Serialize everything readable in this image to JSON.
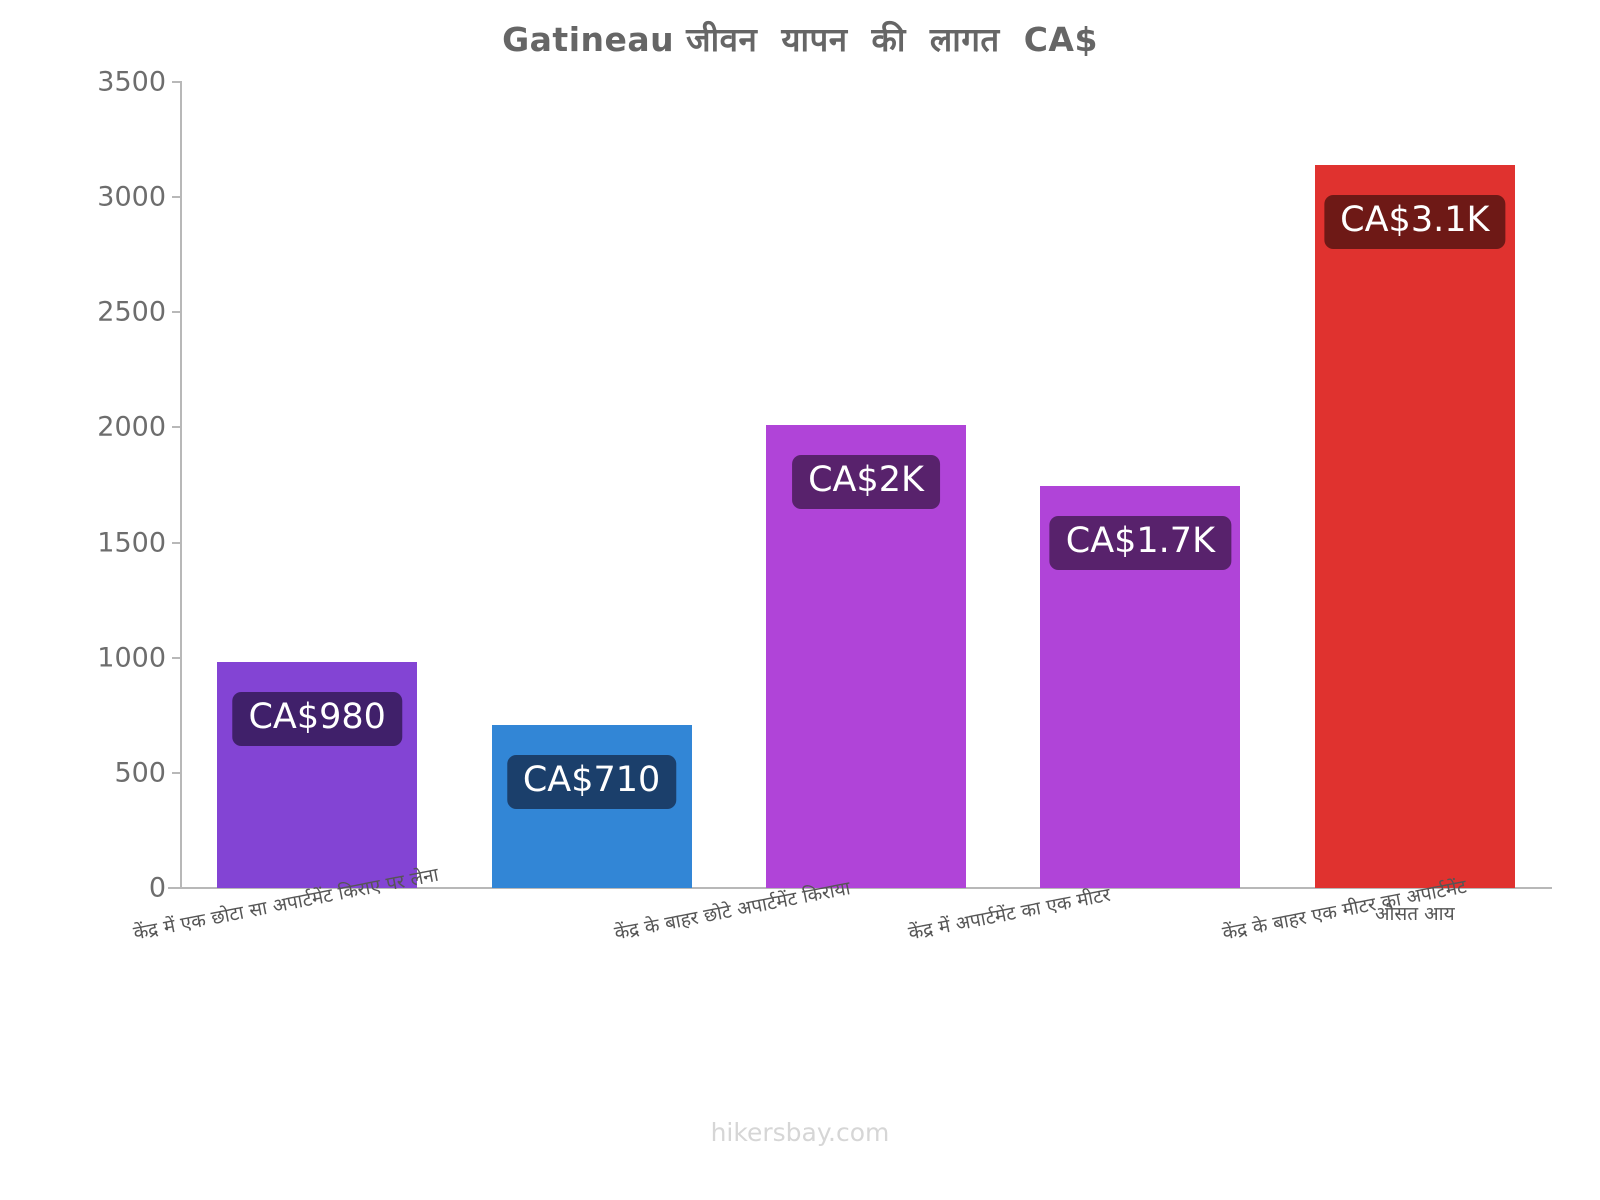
{
  "chart_data": {
    "type": "bar",
    "title": "Gatineau जीवन  यापन  की  लागत  CA$",
    "xlabel": "",
    "ylabel": "",
    "ylim": [
      0,
      3500
    ],
    "yticks": [
      0,
      500,
      1000,
      1500,
      2000,
      2500,
      3000,
      3500
    ],
    "ytick_labels": [
      "0",
      "500",
      "1000",
      "1500",
      "2000",
      "2500",
      "3000",
      "3500"
    ],
    "grid": false,
    "legend": "none",
    "categories": [
      "केंद्र में एक छोटा सा अपार्टमेंट किराए पर लेना",
      "केंद्र के बाहर छोटे अपार्टमेंट किराया",
      "केंद्र में अपार्टमेंट का एक मीटर",
      "केंद्र के बाहर एक मीटर का अपार्टमेंट",
      "औसत आय"
    ],
    "values": [
      980,
      710,
      2010,
      1745,
      3140
    ],
    "data_labels": [
      "CA$980",
      "CA$710",
      "CA$2K",
      "CA$1.7K",
      "CA$3.1K"
    ],
    "bar_colors": [
      "#8344d4",
      "#3286d6",
      "#b044d8",
      "#b044d8",
      "#e0322f"
    ],
    "label_badge_colors": [
      "#40206a",
      "#1b3f6b",
      "#58226c",
      "#58226c",
      "#6e1916"
    ],
    "currency": "CA$"
  },
  "footer": {
    "watermark": "hikersbay.com"
  }
}
